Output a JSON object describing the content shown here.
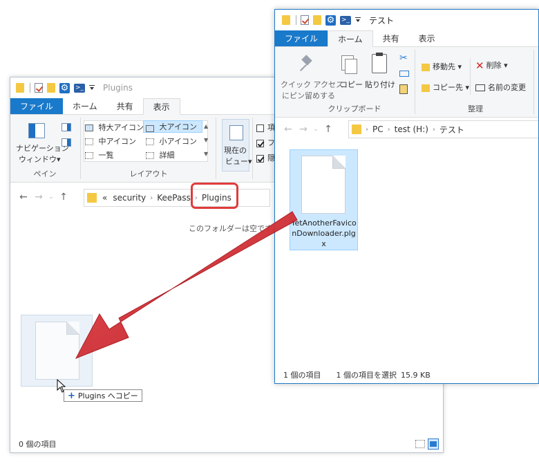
{
  "winA": {
    "title": "Plugins",
    "tabs": [
      "ファイル",
      "ホーム",
      "共有",
      "表示"
    ],
    "ribbon": {
      "nav_pane_l1": "ナビゲーション",
      "nav_pane_l2": "ウィンドウ▾",
      "pane_group": "ペイン",
      "layout_group": "レイアウト",
      "layouts": [
        "特大アイコン",
        "大アイコン",
        "中アイコン",
        "小アイコン",
        "一覧",
        "詳細"
      ],
      "current_view_l1": "現在の",
      "current_view_l2": "ビュー▾",
      "cb_items": [
        "項",
        "フ",
        "隠"
      ]
    },
    "breadcrumb": [
      "«",
      "security",
      "KeePass",
      "Plugins"
    ],
    "empty_message": "このフォルダーは空です。",
    "drag_tooltip": "Plugins へコピー",
    "status": "0 個の項目"
  },
  "winB": {
    "title": "テスト",
    "tabs": [
      "ファイル",
      "ホーム",
      "共有",
      "表示"
    ],
    "ribbon": {
      "quick_access_l1": "クイック アクセス",
      "quick_access_l2": "にピン留めする",
      "copy": "コピー",
      "paste": "貼り付け",
      "clipboard_group": "クリップボード",
      "move_to": "移動先 ▾",
      "copy_to": "コピー先 ▾",
      "delete": "削除 ▾",
      "rename": "名前の変更",
      "organize_group": "整理"
    },
    "breadcrumb": [
      "PC",
      "test (H:)",
      "テスト"
    ],
    "file_name_lines": [
      "YetAnotherFavico",
      "nDownloader.plg",
      "x"
    ],
    "status_count": "1 個の項目",
    "status_selected": "1 個の項目を選択",
    "status_size": "15.9 KB"
  },
  "colors": {
    "file_tab": "#1979ca",
    "highlight_box": "#e03b3b",
    "arrow": "#d9282f",
    "selection": "#cce8ff"
  }
}
